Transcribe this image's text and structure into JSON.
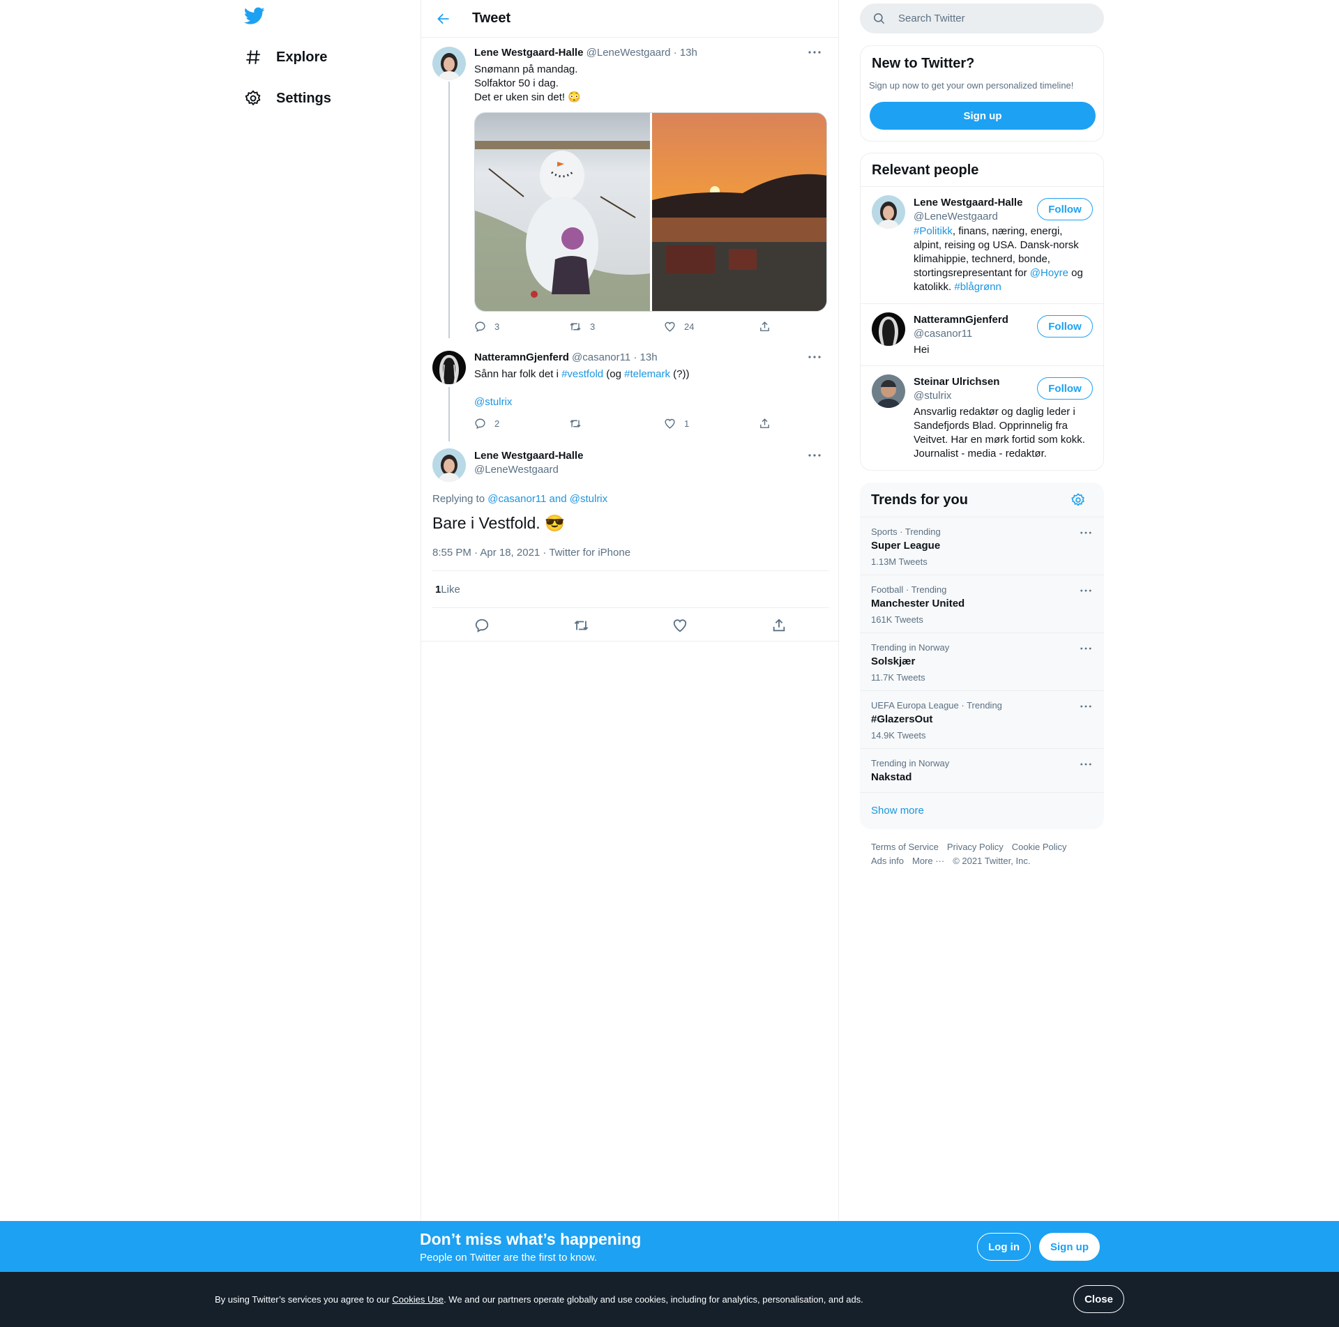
{
  "nav": {
    "items": [
      {
        "label": "Explore"
      },
      {
        "label": "Settings"
      }
    ]
  },
  "header": {
    "title": "Tweet"
  },
  "thread": [
    {
      "name": "Lene Westgaard-Halle",
      "handle": "@LeneWestgaard",
      "time": "· 13h",
      "lines": [
        "Snømann på mandag.",
        "Solfaktor 50 i dag.",
        "Det er uken sin det! 😳"
      ],
      "replies": "3",
      "retweets": "3",
      "likes": "24"
    },
    {
      "name": "NatteramnGjenferd",
      "handle": "@casanor11",
      "time": "· 13h",
      "text_before": "Sånn har folk det i ",
      "tag1": "#vestfold",
      "text_mid": " (og ",
      "tag2": "#telemark",
      "text_after": " (?))",
      "mention": "@stulrix",
      "replies": "2",
      "retweets": "",
      "likes": "1"
    }
  ],
  "main_tweet": {
    "name": "Lene Westgaard-Halle",
    "handle": "@LeneWestgaard",
    "replying_prefix": "Replying to ",
    "replying_to": "@casanor11 and @stulrix",
    "text": "Bare i Vestfold. 😎",
    "meta": "8:55 PM · Apr 18, 2021 · Twitter for iPhone",
    "likes_count": "1",
    "likes_label": " Like"
  },
  "search": {
    "placeholder": "Search Twitter"
  },
  "new_to_twitter": {
    "title": "New to Twitter?",
    "subtitle": "Sign up now to get your own personalized timeline!",
    "signup": "Sign up"
  },
  "relevant": {
    "title": "Relevant people",
    "follow": "Follow",
    "people": [
      {
        "name": "Lene Westgaard-Halle",
        "handle": "@LeneWestgaard",
        "bio_tag1": "#Politikk",
        "bio_1": ", finans, næring, energi, alpint, reising og USA. Dansk-norsk klimahippie, technerd, bonde, stortingsrepresentant for ",
        "bio_tag2": "@Hoyre",
        "bio_2": " og katolikk. ",
        "bio_tag3": "#blågrønn"
      },
      {
        "name": "NatteramnGjenferd",
        "handle": "@casanor11",
        "bio": "Hei"
      },
      {
        "name": "Steinar Ulrichsen",
        "handle": "@stulrix",
        "bio": "Ansvarlig redaktør og daglig leder i Sandefjords Blad. Opprinnelig fra Veitvet. Har en mørk fortid som kokk. Journalist - media - redaktør."
      }
    ]
  },
  "trends": {
    "title": "Trends for you",
    "items": [
      {
        "meta": "Sports · Trending",
        "name": "Super League",
        "count": "1.13M Tweets"
      },
      {
        "meta": "Football · Trending",
        "name": "Manchester United",
        "count": "161K Tweets"
      },
      {
        "meta": "Trending in Norway",
        "name": "Solskjær",
        "count": "11.7K Tweets"
      },
      {
        "meta": "UEFA Europa League · Trending",
        "name": "#GlazersOut",
        "count": "14.9K Tweets"
      },
      {
        "meta": "Trending in Norway",
        "name": "Nakstad",
        "count": ""
      }
    ],
    "show_more": "Show more"
  },
  "footer": {
    "terms": "Terms of Service",
    "privacy": "Privacy Policy",
    "cookie": "Cookie Policy",
    "ads": "Ads info",
    "more": "More ···",
    "copyright": "© 2021 Twitter, Inc."
  },
  "banner": {
    "title": "Don’t miss what’s happening",
    "subtitle": "People on Twitter are the first to know.",
    "login": "Log in",
    "signup": "Sign up"
  },
  "cookie": {
    "text_before": "By using Twitter’s services you agree to our ",
    "link": "Cookies Use",
    "text_after": ". We and our partners operate globally and use cookies, including for analytics, personalisation, and ads.",
    "close": "Close"
  },
  "colors": {
    "accent": "#1da1f2",
    "link": "#1b95e0",
    "muted": "#5b7083",
    "cookie_bg": "#15202b"
  }
}
